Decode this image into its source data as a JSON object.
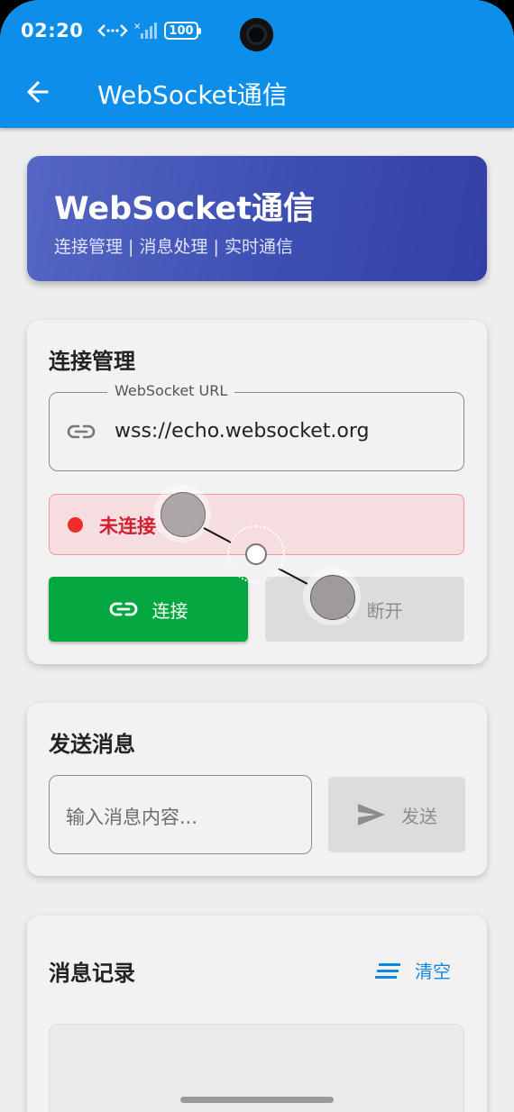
{
  "status_bar": {
    "time": "02:20",
    "battery": "100"
  },
  "app_bar": {
    "title": "WebSocket通信"
  },
  "hero": {
    "title": "WebSocket通信",
    "subtitle": "连接管理 | 消息处理 | 实时通信"
  },
  "connection_card": {
    "title": "连接管理",
    "url_label": "WebSocket URL",
    "url_value": "wss://echo.websocket.org",
    "status_text": "未连接",
    "connect_label": "连接",
    "disconnect_label": "断开"
  },
  "send_card": {
    "title": "发送消息",
    "input_placeholder": "输入消息内容...",
    "send_label": "发送"
  },
  "log_card": {
    "title": "消息记录",
    "clear_label": "清空"
  },
  "colors": {
    "app_bar": "#0d8ee9",
    "connect_button": "#05a840",
    "status_red": "#d32030",
    "clear_blue": "#1287e0"
  },
  "icons": {
    "back": "arrow-left-icon",
    "url": "link-icon",
    "connect": "link-icon",
    "disconnect": "link-off-icon",
    "send": "send-icon",
    "clear": "clear-all-icon"
  }
}
